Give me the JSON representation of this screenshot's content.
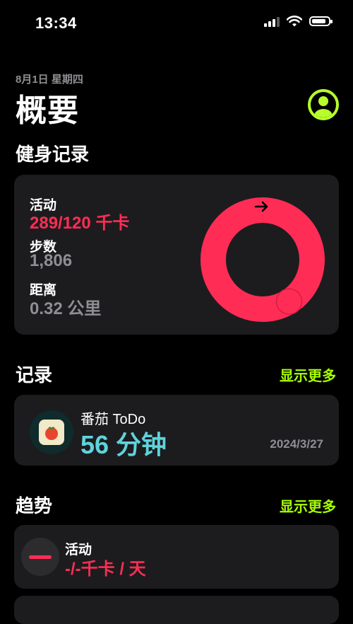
{
  "status_bar": {
    "time": "13:34"
  },
  "header": {
    "date": "8月1日 星期四",
    "title": "概要"
  },
  "fitness": {
    "section_title": "健身记录",
    "move_label": "活动",
    "move_value": "289/120 千卡",
    "steps_label": "步数",
    "steps_value": "1,806",
    "distance_label": "距离",
    "distance_value": "0.32 公里",
    "ring_progress": 2.41,
    "ring_color": "#ff2d55"
  },
  "records": {
    "section_title": "记录",
    "show_more": "显示更多",
    "item": {
      "app_name": "番茄 ToDo",
      "duration": "56 分钟",
      "date": "2024/3/27"
    }
  },
  "trends": {
    "section_title": "趋势",
    "show_more": "显示更多",
    "item": {
      "label": "活动",
      "value": "-/-千卡 / 天"
    }
  },
  "colors": {
    "accent": "#a6ff00",
    "move": "#ff2d55",
    "record_value": "#5fd3dc",
    "card": "#1c1c1e"
  }
}
